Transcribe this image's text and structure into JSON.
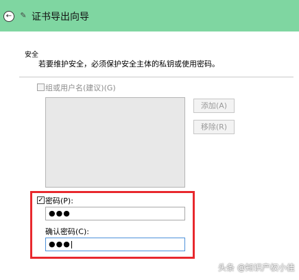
{
  "titlebar": {
    "back_icon": "back-arrow-icon",
    "wizard_icon": "certificate-wizard-icon",
    "title": "证书导出向导",
    "color": "#7fd6a1"
  },
  "security": {
    "heading": "安全",
    "description": "若要维护安全，必须保护安全主体的私钥或使用密码。"
  },
  "group": {
    "checkbox_label": "组或用户名(建议)(G)",
    "checked": false,
    "add_button": "添加(A)",
    "remove_button": "移除(R)"
  },
  "password": {
    "checkbox_label": "密码(P):",
    "checked": true,
    "value": "●●●",
    "confirm_label": "确认密码(C):",
    "confirm_value": "●●●"
  },
  "highlight_color": "#e8282d",
  "watermark": "头条 @知识产权小佳"
}
